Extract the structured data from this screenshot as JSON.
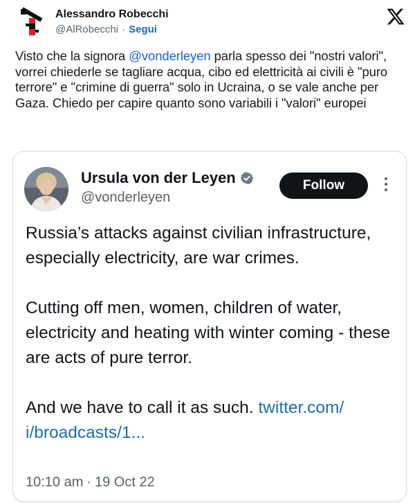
{
  "outer_tweet": {
    "author_name": "Alessandro Robecchi",
    "author_handle": "@AlRobecchi",
    "separator": "·",
    "follow_label": "Segui",
    "text_parts": [
      "Visto che la signora ",
      "@vonderleyen",
      " parla spesso dei \"nostri valori\", vorrei chiederle se tagliare acqua, cibo ed elettricità ai civili è \"puro terrore\" e \"crimine di guerra\" solo in Ucraina, o se vale anche per Gaza. Chiedo per capire quanto sono variabili i \"valori\" europei"
    ],
    "icons": {
      "logo": "robecchi-logo",
      "platform": "x-logo-icon"
    }
  },
  "quoted_tweet": {
    "author_name": "Ursula von der Leyen",
    "author_handle": "@vonderleyen",
    "follow_label": "Follow",
    "paragraph_1": "Russia’s attacks against civilian infrastructure, especially electricity, are war crimes.",
    "paragraph_2": "Cutting off men, women, children of water, electricity and heating with winter coming - these are acts of pure terror.",
    "paragraph_3_text": "And we have to call it as such. ",
    "paragraph_3_link": "twitter.com/ i/broadcasts/1...",
    "time": "10:10 am",
    "separator": "·",
    "date": "19 Oct 22",
    "icons": {
      "verified": "verified-badge-icon",
      "more": "more-options-icon"
    }
  },
  "colors": {
    "link_blue": "#1d64c4",
    "follow_button": "#0f1419",
    "secondary_text": "#536471",
    "logo_red": "#d8202c"
  }
}
